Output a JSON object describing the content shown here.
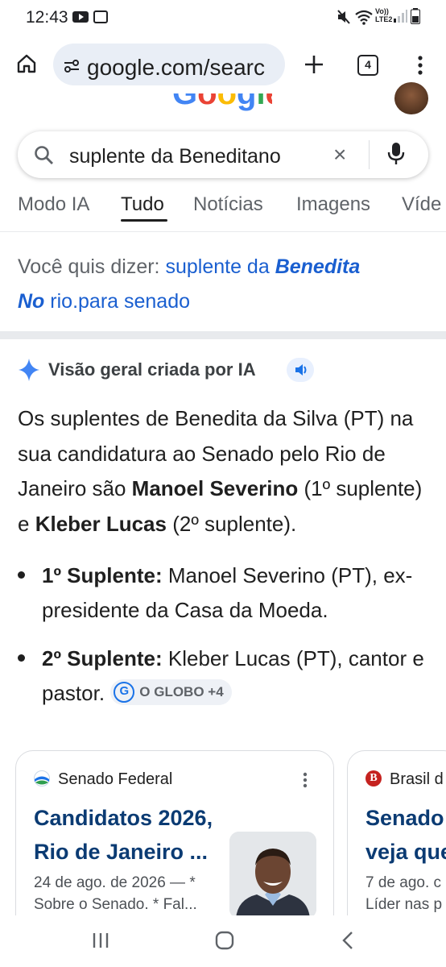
{
  "status_bar": {
    "time": "12:43",
    "network_label_top": "Vo))",
    "network_label_bottom": "LTE2",
    "icons": [
      "youtube-icon",
      "voicemail-icon",
      "mute-icon",
      "wifi-icon",
      "signal-icon",
      "battery-icon"
    ]
  },
  "browser": {
    "url": "google.com/searc",
    "tab_count": "4",
    "icons": [
      "home-icon",
      "site-info-icon",
      "new-tab-icon",
      "tab-switcher-icon",
      "more-vert-icon"
    ]
  },
  "search": {
    "query": "suplente da Beneditano",
    "clear_symbol": "×"
  },
  "tabs": [
    {
      "label": "Modo IA",
      "active": false
    },
    {
      "label": "Tudo",
      "active": true
    },
    {
      "label": "Notícias",
      "active": false
    },
    {
      "label": "Imagens",
      "active": false
    },
    {
      "label": "Víde",
      "active": false
    }
  ],
  "did_you_mean": {
    "prefix": "Você quis dizer:",
    "part1": "suplente da",
    "bold1": "Benedita",
    "bold2": "No",
    "part2": "rio.para senado"
  },
  "ai_overview": {
    "title": "Visão geral criada por IA",
    "intro_1": "Os suplentes de Benedita da Silva (PT) na sua candidatura ao Senado pelo Rio de Janeiro são ",
    "name_1": "Manoel Severino",
    "intro_2": " (1º suplente) e ",
    "name_2": "Kleber Lucas",
    "intro_3": " (2º suplente).",
    "bullets": [
      {
        "label": "1º Suplente:",
        "text": " Manoel Severino (PT), ex-presidente da Casa da Moeda."
      },
      {
        "label": "2º Suplente:",
        "text": " Kleber Lucas (PT), cantor e pastor. "
      }
    ],
    "source_chip": "O GLOBO +4",
    "chip_letter": "G"
  },
  "cards": [
    {
      "source": "Senado Federal",
      "title": "Candidatos 2026, Rio de Janeiro ...",
      "date_line": "24 de ago. de 2026 — *",
      "snippet": "Sobre o Senado. * Fal..."
    },
    {
      "source": "Brasil d",
      "title_line1": "Senado",
      "title_line2": "veja que",
      "date_line": "7 de ago. c",
      "snippet": "Líder nas p"
    }
  ],
  "colors": {
    "link_blue": "#1a0dab",
    "card_title": "#0b3b73",
    "accent_blue": "#1a73e8"
  }
}
